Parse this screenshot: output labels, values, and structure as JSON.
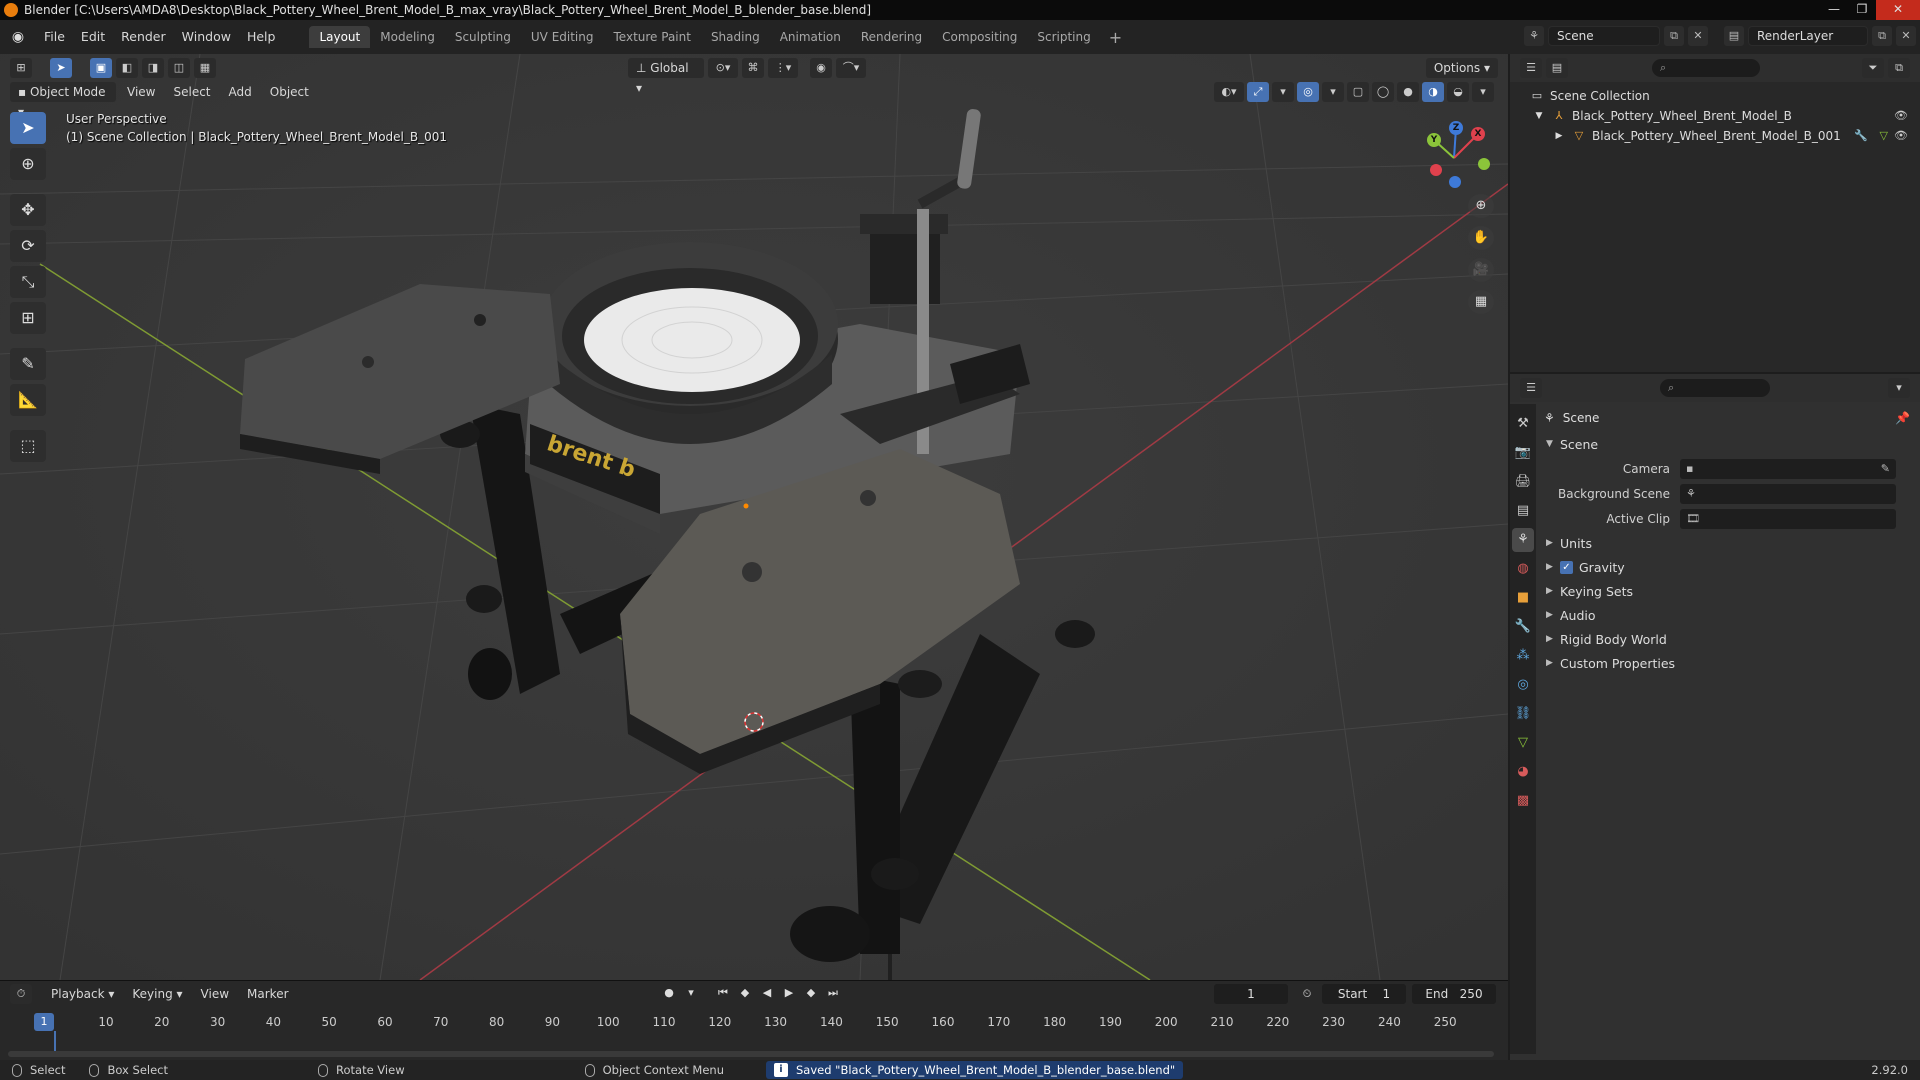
{
  "window": {
    "title": "Blender [C:\\Users\\AMDA8\\Desktop\\Black_Pottery_Wheel_Brent_Model_B_max_vray\\Black_Pottery_Wheel_Brent_Model_B_blender_base.blend]",
    "minimize": "—",
    "maximize": "❐",
    "close": "✕"
  },
  "menu": {
    "items": [
      "File",
      "Edit",
      "Render",
      "Window",
      "Help"
    ]
  },
  "workspaces": {
    "tabs": [
      "Layout",
      "Modeling",
      "Sculpting",
      "UV Editing",
      "Texture Paint",
      "Shading",
      "Animation",
      "Rendering",
      "Compositing",
      "Scripting"
    ],
    "active": "Layout",
    "add": "+"
  },
  "scene_selector": {
    "scene": "Scene",
    "view_layer": "RenderLayer"
  },
  "viewport": {
    "mode": "Object Mode",
    "menus": [
      "View",
      "Select",
      "Add",
      "Object"
    ],
    "transform_orientation": "Global",
    "options_label": "Options",
    "overlay_line1": "User Perspective",
    "overlay_line2": "(1) Scene Collection | Black_Pottery_Wheel_Brent_Model_B_001",
    "model_label": "brent b"
  },
  "gizmo": {
    "x": "X",
    "y": "Y",
    "z": "Z"
  },
  "outliner": {
    "root": "Scene Collection",
    "items": [
      {
        "label": "Black_Pottery_Wheel_Brent_Model_B"
      },
      {
        "label": "Black_Pottery_Wheel_Brent_Model_B_001"
      }
    ]
  },
  "properties": {
    "context_title": "Scene",
    "panel_scene": "Scene",
    "fields": [
      {
        "label": "Camera",
        "value": ""
      },
      {
        "label": "Background Scene",
        "value": ""
      },
      {
        "label": "Active Clip",
        "value": ""
      }
    ],
    "panels": [
      "Units",
      "Gravity",
      "Keying Sets",
      "Audio",
      "Rigid Body World",
      "Custom Properties"
    ],
    "gravity_checked": true
  },
  "timeline": {
    "menus": [
      "Playback",
      "Keying",
      "View",
      "Marker"
    ],
    "current_frame": "1",
    "start_label": "Start",
    "start_value": "1",
    "end_label": "End",
    "end_value": "250",
    "ticks": [
      "10",
      "20",
      "30",
      "40",
      "50",
      "60",
      "70",
      "80",
      "90",
      "100",
      "110",
      "120",
      "130",
      "140",
      "150",
      "160",
      "170",
      "180",
      "190",
      "200",
      "210",
      "220",
      "230",
      "240",
      "250"
    ],
    "marker_value": "1"
  },
  "statusbar": {
    "select": "Select",
    "box_select": "Box Select",
    "rotate_view": "Rotate View",
    "context_menu": "Object Context Menu",
    "message": "Saved \"Black_Pottery_Wheel_Brent_Model_B_blender_base.blend\"",
    "version": "2.92.0"
  },
  "colors": {
    "accent": "#4772b3",
    "axis_x": "#e0414d",
    "axis_y": "#8bc43a",
    "axis_z": "#3e7ad9"
  }
}
